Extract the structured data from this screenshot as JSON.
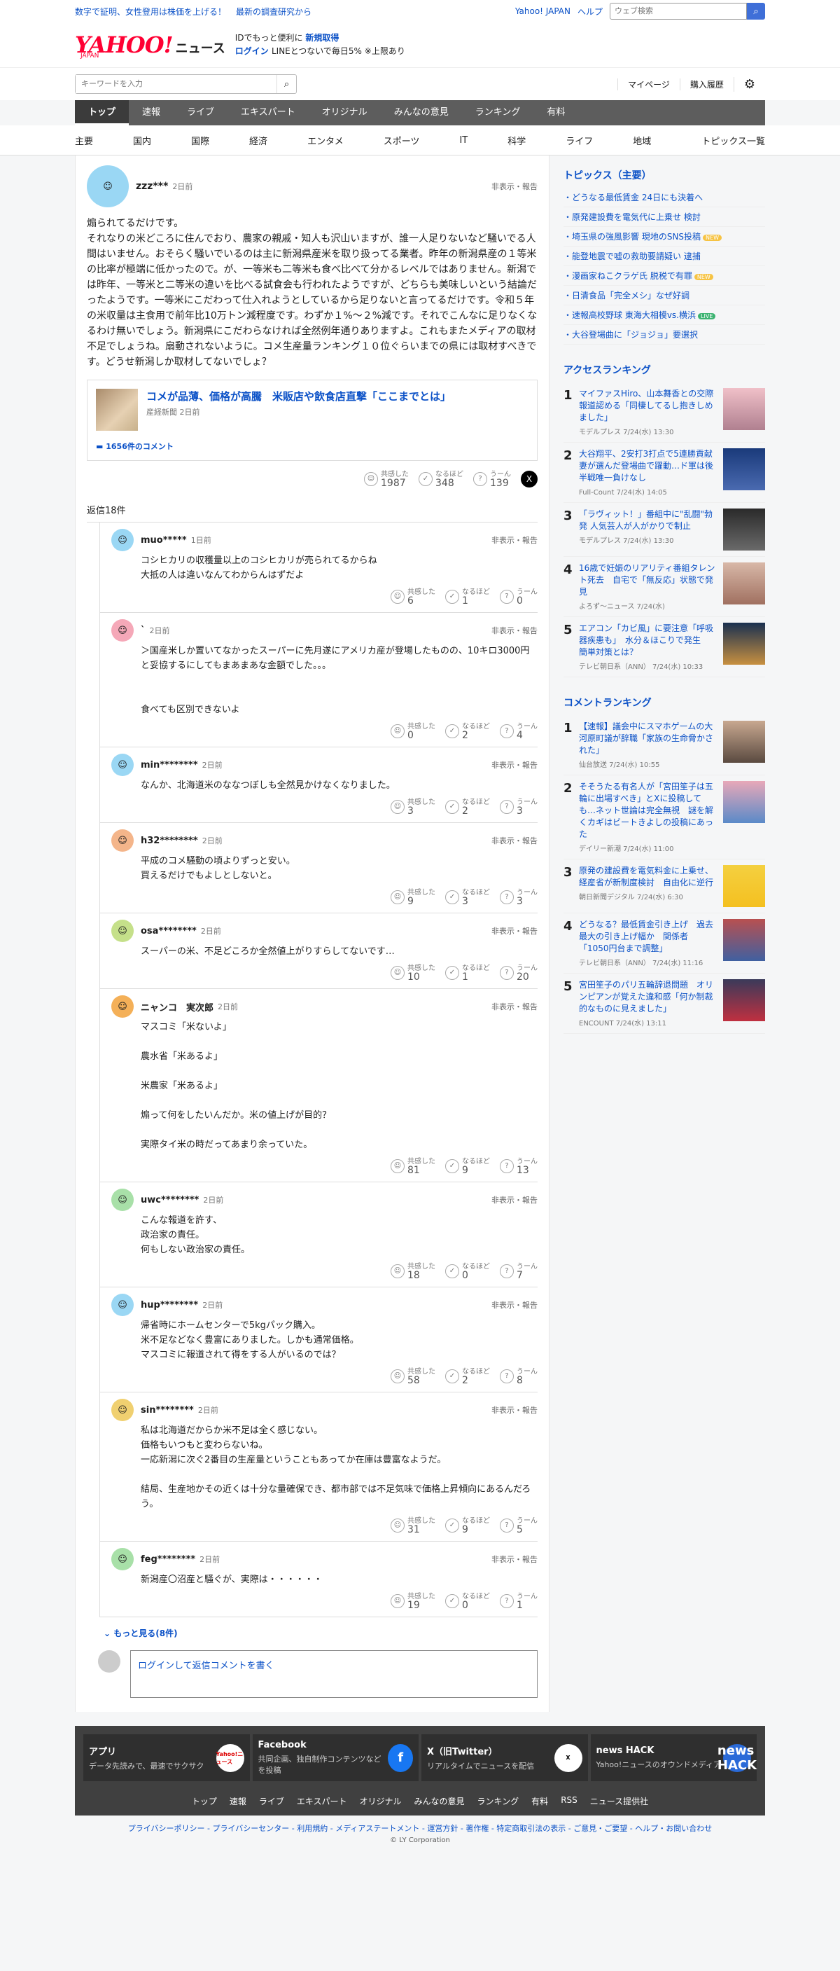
{
  "topbar": {
    "links": [
      "数字で証明、女性登用は株価を上げる！",
      "最新の調査研究から"
    ],
    "yahoo": "Yahoo! JAPAN",
    "help": "ヘルプ",
    "search_placeholder": "ウェブ検索"
  },
  "header": {
    "logo": "YAHOO!",
    "japan": "JAPAN",
    "news": "ニュース",
    "promo1": "IDでもっと便利に",
    "promo1b": "新規取得",
    "login": "ログイン",
    "promo2": "LINEとつないで毎日5% ※上限あり"
  },
  "search": {
    "placeholder": "キーワードを入力",
    "mypage": "マイページ",
    "history": "購入履歴"
  },
  "nav": [
    "トップ",
    "速報",
    "ライブ",
    "エキスパート",
    "オリジナル",
    "みんなの意見",
    "ランキング",
    "有料"
  ],
  "subnav": [
    "主要",
    "国内",
    "国際",
    "経済",
    "エンタメ",
    "スポーツ",
    "IT",
    "科学",
    "ライフ",
    "地域"
  ],
  "subnav_all": "トピックス一覧",
  "post": {
    "user": "zzz***",
    "date": "2日前",
    "hide": "非表示・報告",
    "text": "煽られてるだけです。\nそれなりの米どころに住んでおり、農家の親戚・知人も沢山いますが、誰一人足りないなど騒いでる人間はいません。おそらく騒いでいるのは主に新潟県産米を取り扱ってる業者。昨年の新潟県産の１等米の比率が極端に低かったので。が、一等米も二等米も食べ比べて分かるレベルではありません。新潟では昨年、一等米と二等米の違いを比べる試食会も行われたようですが、どちらも美味しいという結論だったようです。一等米にこだわって仕入れようとしているから足りないと言ってるだけです。令和５年の米収量は主食用で前年比10万トン減程度です。わずか１%～２%減です。それでこんなに足りなくなるわけ無いでしょう。新潟県にこだわらなければ全然例年通りありますよ。これもまたメディアの取材不足でしょうね。扇動されないように。コメ生産量ランキング１０位ぐらいまでの県には取材すべきです。どうせ新潟しか取材してないでしょ？",
    "card": {
      "title": "コメが品薄、価格が高騰　米販店や飲食店直撃「ここまでとは」",
      "source": "産経新聞 2日前",
      "comments": "1656件のコメント"
    },
    "reactions": {
      "l1": "共感した",
      "n1": "1987",
      "l2": "なるほど",
      "n2": "348",
      "l3": "うーん",
      "n3": "139"
    }
  },
  "reply_header": "返信18件",
  "labels": {
    "empathy": "共感した",
    "naruhodo": "なるほど",
    "uun": "うーん",
    "hide": "非表示・報告"
  },
  "replies": [
    {
      "user": "muo*****",
      "date": "1日前",
      "text": "コシヒカリの収穫量以上のコシヒカリが売られてるからね\n大抵の人は違いなんてわからんはずだよ",
      "a": "6",
      "b": "1",
      "c": "0"
    },
    {
      "user": "`",
      "date": "2日前",
      "text": "＞国産米しか置いてなかったスーパーに先月遂にアメリカ産が登場したものの、10キロ3000円と妥協するにしてもまあまあな金額でした。。。\n\n\n食べても区別できないよ",
      "a": "0",
      "b": "2",
      "c": "4"
    },
    {
      "user": "min********",
      "date": "2日前",
      "text": "なんか、北海道米のななつぼしも全然見かけなくなりました。",
      "a": "3",
      "b": "2",
      "c": "3"
    },
    {
      "user": "h32********",
      "date": "2日前",
      "text": "平成のコメ騒動の頃よりずっと安い。\n買えるだけでもよしとしないと。",
      "a": "9",
      "b": "3",
      "c": "3"
    },
    {
      "user": "osa********",
      "date": "2日前",
      "text": "スーパーの米、不足どころか全然値上がりすらしてないです…",
      "a": "10",
      "b": "1",
      "c": "20"
    },
    {
      "user": "ニャンコ　実次郎",
      "date": "2日前",
      "text": "マスコミ「米ないよ」\n\n農水省「米あるよ」\n\n米農家「米あるよ」\n\n煽って何をしたいんだか。米の値上げが目的？\n\n実際タイ米の時だってあまり余っていた。",
      "a": "81",
      "b": "9",
      "c": "13"
    },
    {
      "user": "uwc********",
      "date": "2日前",
      "text": "こんな報道を許す、\n政治家の責任。\n何もしない政治家の責任。",
      "a": "18",
      "b": "0",
      "c": "7"
    },
    {
      "user": "hup********",
      "date": "2日前",
      "text": "帰省時にホームセンターで5kgパック購入。\n米不足などなく豊富にありました。しかも通常価格。\nマスコミに報道されて得をする人がいるのでは？",
      "a": "58",
      "b": "2",
      "c": "8"
    },
    {
      "user": "sin********",
      "date": "2日前",
      "text": "私は北海道だからか米不足は全く感じない。\n価格もいつもと変わらないね。\n一応新潟に次ぐ2番目の生産量ということもあってか在庫は豊富なようだ。\n\n結局、生産地かその近くは十分な量確保でき、都市部では不足気味で価格上昇傾向にあるんだろう。",
      "a": "31",
      "b": "9",
      "c": "5"
    },
    {
      "user": "feg********",
      "date": "2日前",
      "text": "新潟産〇沼産と騒ぐが、実際は・・・・・・",
      "a": "19",
      "b": "0",
      "c": "1"
    }
  ],
  "more": "もっと見る(8件)",
  "login_prompt": "ログイン",
  "login_prompt_rest": "して返信コメントを書く",
  "side": {
    "topics_title": "トピックス（主要）",
    "topics": [
      "どうなる最低賃金 24日にも決着へ",
      "原発建設費を電気代に上乗せ 検討",
      "埼玉県の強風影響 現地のSNS投稿",
      "能登地震で嘘の救助要請疑い 逮捕",
      "漫画家ねこクラゲ氏 脱税で有罪",
      "日清食品「完全メシ」なぜ好調",
      "速報高校野球 東海大相模vs.横浜",
      "大谷登場曲に「ジョジョ」要選択"
    ],
    "badges": [
      "",
      "",
      "NEW",
      "",
      "NEW",
      "",
      "LIVE",
      ""
    ],
    "access_title": "アクセスランキング",
    "access": [
      {
        "t": "マイファスHiro、山本舞香との交際報道認める「同棲してるし抱きしめました」",
        "m": "モデルプレス 7/24(水) 13:30"
      },
      {
        "t": "大谷翔平、2安打3打点で5連勝貢献　妻が選んだ登場曲で躍動…ド軍は後半戦唯一負けなし",
        "m": "Full-Count 7/24(水) 14:05"
      },
      {
        "t": "「ラヴィット！」番組中に\"乱闘\"勃発 人気芸人が人がかりで制止",
        "m": "モデルプレス 7/24(水) 13:30"
      },
      {
        "t": "16歳で妊娠のリアリティ番組タレント死去　自宅で「無反応」状態で発見",
        "m": "よろず〜ニュース 7/24(水)"
      },
      {
        "t": "エアコン「カビ風」に要注意「呼吸器疾患も」　水分＆ほこりで発生　簡単対策とは？",
        "m": "テレビ朝日系（ANN） 7/24(水) 10:33"
      }
    ],
    "comment_title": "コメントランキング",
    "comment": [
      {
        "t": "【速報】議会中にスマホゲームの大河原町議が辞職「家族の生命脅かされた」",
        "m": "仙台放送 7/24(水) 10:55"
      },
      {
        "t": "そそうたる有名人が「宮田笙子は五輪に出場すべき」とXに投稿しても…ネット世論は完全無視　謎を解くカギはビートきよしの投稿にあった",
        "m": "デイリー新潮 7/24(水) 11:00"
      },
      {
        "t": "原発の建設費を電気料金に上乗せ、経産省が新制度検討　自由化に逆行",
        "m": "朝日新聞デジタル 7/24(水) 6:30"
      },
      {
        "t": "どうなる？最低賃金引き上げ　過去最大の引き上げ幅か　関係者「1050円台まで調整」",
        "m": "テレビ朝日系（ANN） 7/24(水) 11:16"
      },
      {
        "t": "宮田笙子のパリ五輪辞退問題　オリンピアンが覚えた違和感「何か制裁的なものに見えました」",
        "m": "ENCOUNT 7/24(水) 13:11"
      }
    ]
  },
  "footer": {
    "cards": [
      {
        "t": "アプリ",
        "d": "データ先読みで、最速でサクサク",
        "icon": "Yahoo!ニュース"
      },
      {
        "t": "Facebook",
        "d": "共同企画、独自制作コンテンツなどを投稿",
        "icon": "f"
      },
      {
        "t": "X（旧Twitter）",
        "d": "リアルタイムでニュースを配信",
        "icon": "X"
      },
      {
        "t": "news HACK",
        "d": "Yahoo!ニュースのオウンドメディア",
        "icon": "news HACK"
      }
    ],
    "links": [
      "トップ",
      "速報",
      "ライブ",
      "エキスパート",
      "オリジナル",
      "みんなの意見",
      "ランキング",
      "有料",
      "RSS",
      "ニュース提供社"
    ],
    "legal": "プライバシーポリシー - プライバシーセンター - 利用規約 - メディアステートメント - 運営方針 - 著作権 - 特定商取引法の表示 - ご意見・ご要望 - ヘルプ・お問い合わせ",
    "copy": "© LY Corporation"
  }
}
